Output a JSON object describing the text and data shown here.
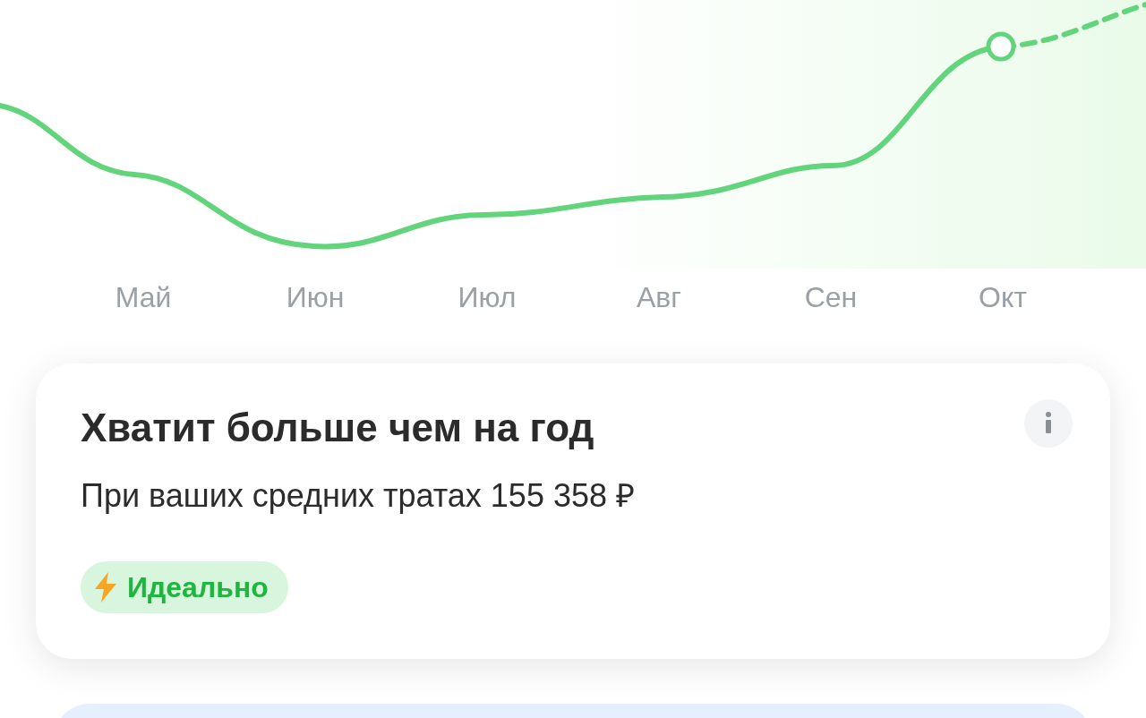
{
  "chart": {
    "months": [
      "Май",
      "Июн",
      "Июл",
      "Авг",
      "Сен",
      "Окт"
    ]
  },
  "summary_card": {
    "title": "Хватит больше чем на год",
    "subtitle": "При ваших средних тратах 155 358 ₽",
    "badge": "Идеально"
  }
}
